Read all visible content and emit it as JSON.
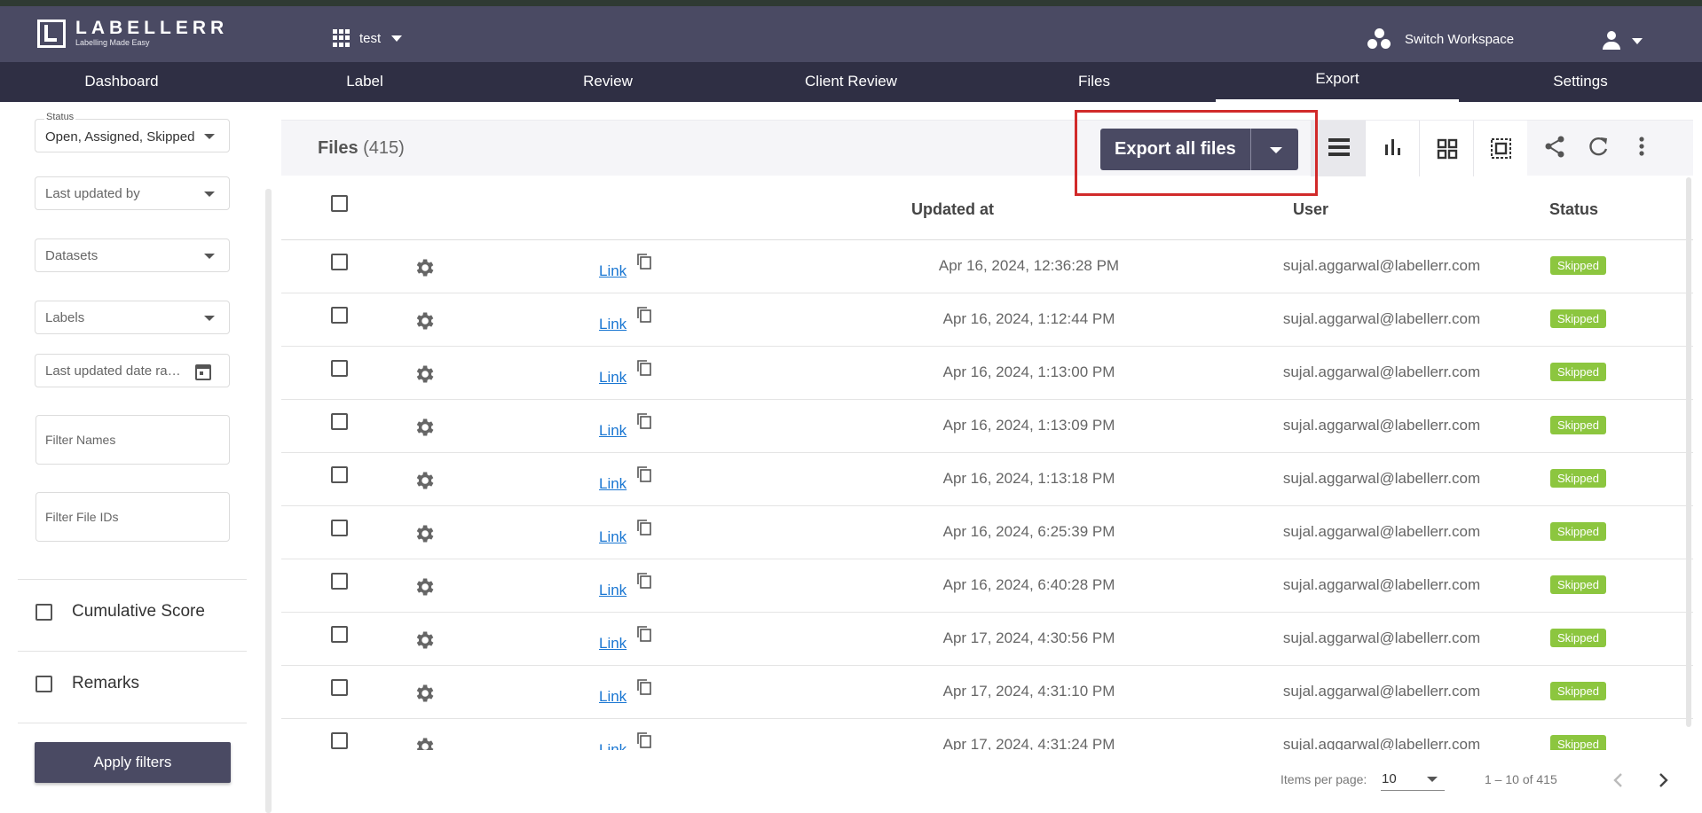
{
  "brand": {
    "name": "LABELLERR",
    "tagline": "Labelling Made Easy"
  },
  "workspace": {
    "project": "test",
    "switch_label": "Switch Workspace"
  },
  "nav": {
    "items": [
      "Dashboard",
      "Label",
      "Review",
      "Client Review",
      "Files",
      "Export",
      "Settings"
    ],
    "active": "Export"
  },
  "filters": {
    "status": {
      "legend": "Status",
      "value": "Open, Assigned, Skipped"
    },
    "last_updated_by": "Last updated by",
    "datasets": "Datasets",
    "labels": "Labels",
    "last_updated_date": "Last updated date range",
    "filter_names_placeholder": "Filter Names",
    "filter_file_ids_placeholder": "Filter File IDs",
    "cumulative_score": "Cumulative Score",
    "remarks": "Remarks",
    "apply_label": "Apply filters"
  },
  "files": {
    "title": "Files",
    "count": "(415)",
    "export_label": "Export all files",
    "view_icons": [
      "list-view-icon",
      "bar-chart-icon",
      "grid-view-icon",
      "select-all-icon"
    ],
    "tool_icons": [
      "share-icon",
      "refresh-icon",
      "more-vert-icon"
    ]
  },
  "table": {
    "headers": {
      "updated_at": "Updated at",
      "user": "User",
      "status": "Status"
    },
    "link_text": "Link",
    "rows": [
      {
        "updated": "Apr 16, 2024, 12:36:28 PM",
        "user": "sujal.aggarwal@labellerr.com",
        "status": "Skipped"
      },
      {
        "updated": "Apr 16, 2024, 1:12:44 PM",
        "user": "sujal.aggarwal@labellerr.com",
        "status": "Skipped"
      },
      {
        "updated": "Apr 16, 2024, 1:13:00 PM",
        "user": "sujal.aggarwal@labellerr.com",
        "status": "Skipped"
      },
      {
        "updated": "Apr 16, 2024, 1:13:09 PM",
        "user": "sujal.aggarwal@labellerr.com",
        "status": "Skipped"
      },
      {
        "updated": "Apr 16, 2024, 1:13:18 PM",
        "user": "sujal.aggarwal@labellerr.com",
        "status": "Skipped"
      },
      {
        "updated": "Apr 16, 2024, 6:25:39 PM",
        "user": "sujal.aggarwal@labellerr.com",
        "status": "Skipped"
      },
      {
        "updated": "Apr 16, 2024, 6:40:28 PM",
        "user": "sujal.aggarwal@labellerr.com",
        "status": "Skipped"
      },
      {
        "updated": "Apr 17, 2024, 4:30:56 PM",
        "user": "sujal.aggarwal@labellerr.com",
        "status": "Skipped"
      },
      {
        "updated": "Apr 17, 2024, 4:31:10 PM",
        "user": "sujal.aggarwal@labellerr.com",
        "status": "Skipped"
      },
      {
        "updated": "Apr 17, 2024, 4:31:24 PM",
        "user": "sujal.aggarwal@labellerr.com",
        "status": "Skipped"
      }
    ]
  },
  "pagination": {
    "items_per_page_label": "Items per page:",
    "items_per_page": "10",
    "range": "1 – 10 of 415"
  },
  "colors": {
    "topbar": "#4a4a63",
    "nav": "#2f2f44",
    "status_skipped": "#8cc63f",
    "link": "#1976d2",
    "highlight": "#d12a2a"
  }
}
